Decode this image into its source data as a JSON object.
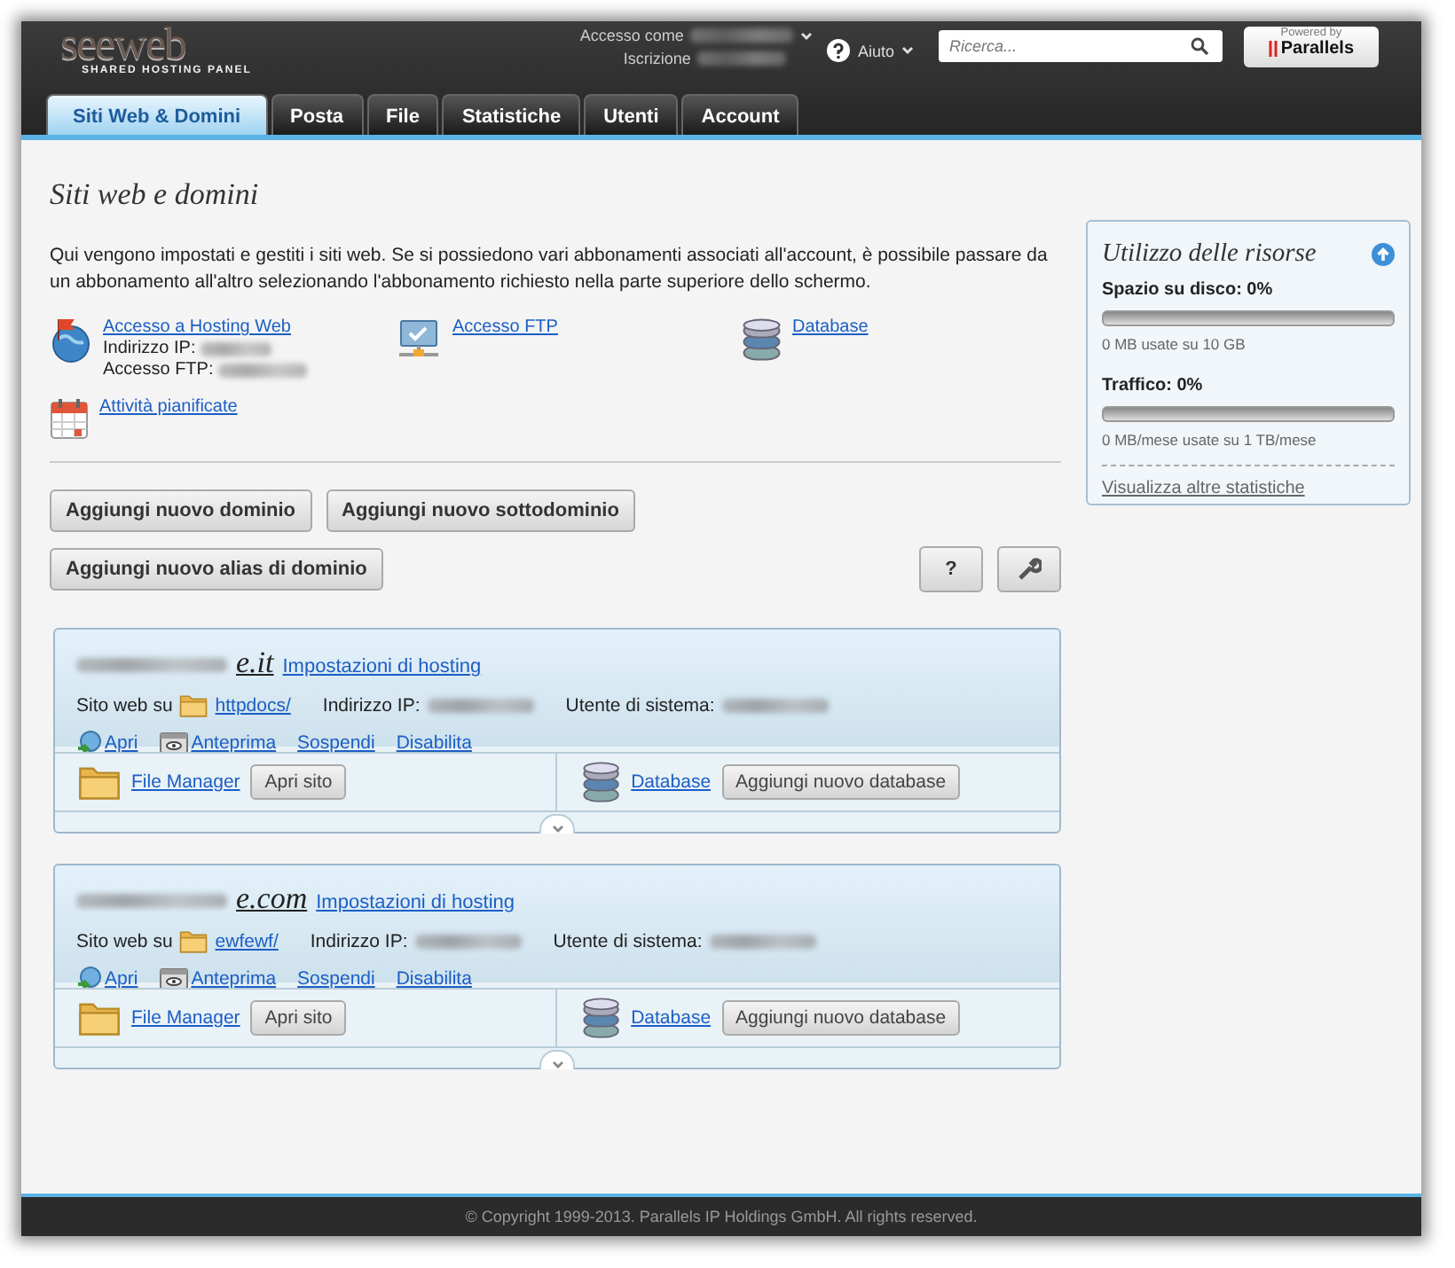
{
  "header": {
    "logo": "seeweb",
    "tagline": "SHARED HOSTING PANEL",
    "account_label": "Accesso come",
    "subscription_label": "Iscrizione",
    "help": "Aiuto",
    "search": {
      "placeholder": "Ricerca..."
    },
    "powered_by": {
      "label": "Powered by",
      "brand": "Parallels"
    }
  },
  "tabs": [
    {
      "label": "Siti Web & Domini",
      "selected": true
    },
    {
      "label": "Posta",
      "selected": false
    },
    {
      "label": "File",
      "selected": false
    },
    {
      "label": "Statistiche",
      "selected": false
    },
    {
      "label": "Utenti",
      "selected": false
    },
    {
      "label": "Account",
      "selected": false
    }
  ],
  "page_title": "Siti web e domini",
  "intro": "Qui vengono impostati e gestiti i siti web. Se si possiedono vari abbonamenti associati all'account, è possibile passare da un abbonamento all'altro selezionando l'abbonamento richiesto nella parte superiore dello schermo.",
  "tools": [
    {
      "kind": "hosting",
      "link": "Accesso a Hosting Web",
      "details": [
        "Indirizzo IP:",
        "Accesso FTP:"
      ]
    },
    {
      "kind": "ftp",
      "link": "Accesso FTP"
    },
    {
      "kind": "database",
      "link": "Database"
    },
    {
      "kind": "calendar",
      "link": "Attività pianificate"
    }
  ],
  "add_buttons": [
    "Aggiungi nuovo dominio",
    "Aggiungi nuovo sottodominio",
    "Aggiungi nuovo alias di dominio"
  ],
  "help_button": "?",
  "domains": [
    {
      "name": "e.it",
      "settings": "Impostazioni di hosting",
      "site_label": "Sito web su",
      "folder": "httpdocs/",
      "ip_label": "Indirizzo IP:",
      "user_label": "Utente di sistema:",
      "actions": [
        {
          "kind": "open",
          "label": "Apri"
        },
        {
          "kind": "preview",
          "label": "Anteprima"
        },
        {
          "kind": "plain",
          "label": "Sospendi"
        },
        {
          "kind": "plain",
          "label": "Disabilita"
        }
      ],
      "file_manager": "File Manager",
      "open_site": "Apri sito",
      "database": "Database",
      "add_database": "Aggiungi nuovo database"
    },
    {
      "name": "e.com",
      "settings": "Impostazioni di hosting",
      "site_label": "Sito web su",
      "folder": "ewfewf/",
      "ip_label": "Indirizzo IP:",
      "user_label": "Utente di sistema:",
      "actions": [
        {
          "kind": "open",
          "label": "Apri"
        },
        {
          "kind": "preview",
          "label": "Anteprima"
        },
        {
          "kind": "plain",
          "label": "Sospendi"
        },
        {
          "kind": "plain",
          "label": "Disabilita"
        }
      ],
      "file_manager": "File Manager",
      "open_site": "Apri sito",
      "database": "Database",
      "add_database": "Aggiungi nuovo database"
    }
  ],
  "resources": {
    "title": "Utilizzo delle risorse",
    "meters": [
      {
        "label": "Spazio su disco: 0%",
        "level": 0,
        "usage": "0 MB usate su 10 GB"
      },
      {
        "label": "Traffico: 0%",
        "level": 0,
        "usage": "0 MB/mese usate su 1 TB/mese"
      }
    ],
    "link": "Visualizza altre statistiche"
  },
  "footer": "© Copyright 1999-2013. Parallels IP Holdings GmbH. All rights reserved."
}
